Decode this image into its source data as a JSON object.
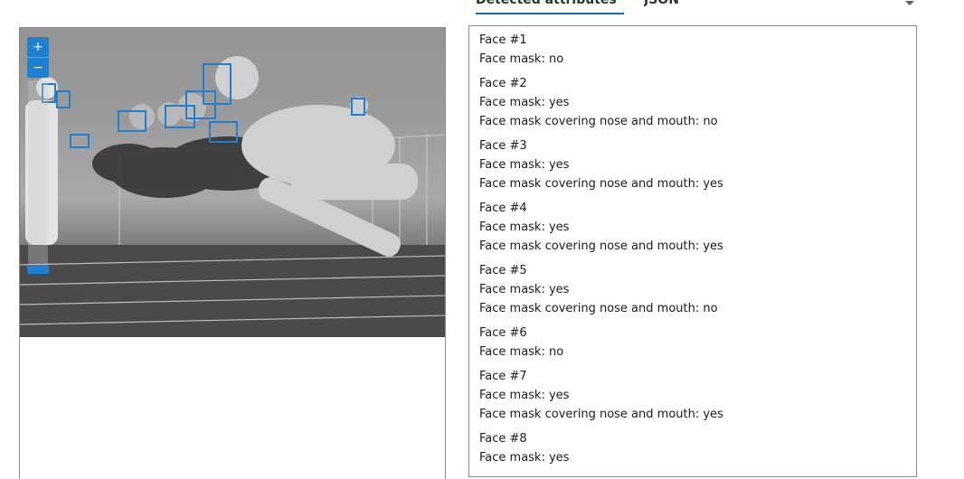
{
  "tabs": {
    "detected_label": "Detected attributes",
    "json_label": "JSON"
  },
  "faces": [
    {
      "title": "Face #1",
      "mask": "Face mask: no",
      "covering": ""
    },
    {
      "title": "Face #2",
      "mask": "Face mask: yes",
      "covering": "Face mask covering nose and mouth: no"
    },
    {
      "title": "Face #3",
      "mask": "Face mask: yes",
      "covering": "Face mask covering nose and mouth: yes"
    },
    {
      "title": "Face #4",
      "mask": "Face mask: yes",
      "covering": "Face mask covering nose and mouth: yes"
    },
    {
      "title": "Face #5",
      "mask": "Face mask: yes",
      "covering": "Face mask covering nose and mouth: no"
    },
    {
      "title": "Face #6",
      "mask": "Face mask: no",
      "covering": ""
    },
    {
      "title": "Face #7",
      "mask": "Face mask: yes",
      "covering": "Face mask covering nose and mouth: yes"
    },
    {
      "title": "Face #8",
      "mask": "Face mask: yes",
      "covering": ""
    }
  ],
  "zoom": {
    "in_label": "+",
    "out_label": "−"
  },
  "colors": {
    "accent": "#0f6cbd",
    "box": "#1f7fd0"
  }
}
